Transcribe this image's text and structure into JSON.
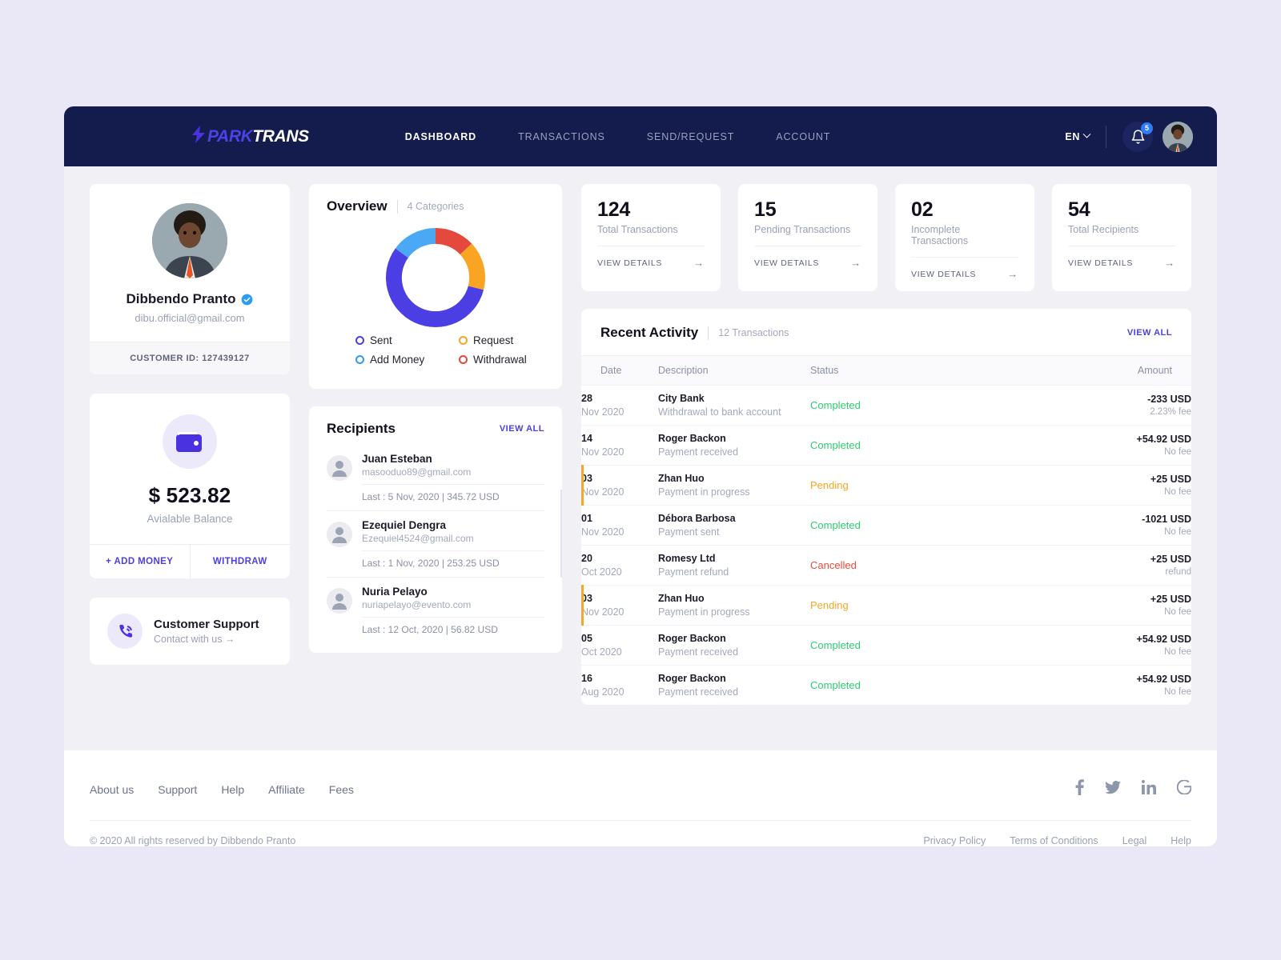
{
  "brand": {
    "bolt": "⚡",
    "park": "PARK",
    "trans": "TRANS"
  },
  "nav": {
    "items": [
      {
        "label": "DASHBOARD",
        "active": true
      },
      {
        "label": "TRANSACTIONS",
        "active": false
      },
      {
        "label": "SEND/REQUEST",
        "active": false
      },
      {
        "label": "ACCOUNT",
        "active": false
      }
    ],
    "language": "EN",
    "notification_count": "5"
  },
  "profile": {
    "name": "Dibbendo Pranto",
    "email": "dibu.official@gmail.com",
    "customer_id": "CUSTOMER ID: 127439127",
    "verified_icon": "verified-badge-icon"
  },
  "wallet": {
    "icon": "wallet-icon",
    "amount": "$ 523.82",
    "label": "Avialable Balance",
    "add_money": "+ ADD MONEY",
    "withdraw": "WITHDRAW"
  },
  "support": {
    "icon": "phone-call-icon",
    "title": "Customer Support",
    "subtitle": "Contact with us →"
  },
  "stats": [
    {
      "value": "124",
      "label": "Total Transactions",
      "link": "VIEW DETAILS"
    },
    {
      "value": "15",
      "label": "Pending Transactions",
      "link": "VIEW DETAILS"
    },
    {
      "value": "02",
      "label": "Incomplete Transactions",
      "link": "VIEW DETAILS"
    },
    {
      "value": "54",
      "label": "Total Recipients",
      "link": "VIEW DETAILS"
    }
  ],
  "overview": {
    "title": "Overview",
    "subtitle": "4  Categories"
  },
  "chart_data": {
    "type": "pie",
    "title": "Overview",
    "subtitle": "4 Categories",
    "legend_position": "bottom",
    "categories": [
      "Withdrawal",
      "Request",
      "Sent",
      "Add Money"
    ],
    "values": [
      13,
      16,
      56,
      15
    ],
    "colors": [
      "#e5483c",
      "#faa424",
      "#4b3fe4",
      "#4aa8f5"
    ],
    "legend": [
      {
        "label": "Sent",
        "color": "#4b3fe4"
      },
      {
        "label": "Request",
        "color": "#faa424"
      },
      {
        "label": "Add Money",
        "color": "#2f9bf5"
      },
      {
        "label": "Withdrawal",
        "color": "#e5483c"
      }
    ],
    "start_angle_deg": 0,
    "direction": "clockwise",
    "inner_radius_ratio": 0.68
  },
  "recipients": {
    "title": "Recipients",
    "view_all": "VIEW ALL",
    "items": [
      {
        "name": "Juan Esteban",
        "email": "masooduo89@gmail.com",
        "last": "Last : 5 Nov, 2020 | 345.72 USD"
      },
      {
        "name": "Ezequiel Dengra",
        "email": "Ezequiel4524@gmail.com",
        "last": "Last : 1 Nov, 2020 | 253.25 USD"
      },
      {
        "name": "Nuria Pelayo",
        "email": "nuriapelayo@evento.com",
        "last": "Last : 12 Oct, 2020 | 56.82 USD"
      }
    ]
  },
  "activity": {
    "title": "Recent Activity",
    "subtitle": "12 Transactions",
    "view_all": "VIEW ALL",
    "columns": [
      "Date",
      "Description",
      "Status",
      "Amount"
    ],
    "status_colors": {
      "Completed": "#2ecc71",
      "Pending": "#f5a623",
      "Cancelled": "#ec4b3a"
    },
    "rows": [
      {
        "day": "28",
        "month": "Nov 2020",
        "title": "City Bank",
        "sub": "Withdrawal to bank account",
        "status": "Completed",
        "amount": "-233 USD",
        "fee": "2.23% fee",
        "marked": false
      },
      {
        "day": "14",
        "month": "Nov 2020",
        "title": "Roger Backon",
        "sub": "Payment received",
        "status": "Completed",
        "amount": "+54.92 USD",
        "fee": "No fee",
        "marked": false
      },
      {
        "day": "03",
        "month": "Nov 2020",
        "title": "Zhan Huo",
        "sub": "Payment in progress",
        "status": "Pending",
        "amount": "+25 USD",
        "fee": "No fee",
        "marked": true
      },
      {
        "day": "01",
        "month": "Nov 2020",
        "title": "Débora Barbosa",
        "sub": "Payment sent",
        "status": "Completed",
        "amount": "-1021 USD",
        "fee": "No fee",
        "marked": false
      },
      {
        "day": "20",
        "month": "Oct 2020",
        "title": "Romesy Ltd",
        "sub": "Payment refund",
        "status": "Cancelled",
        "amount": "+25 USD",
        "fee": "refund",
        "marked": false
      },
      {
        "day": "03",
        "month": "Nov 2020",
        "title": "Zhan Huo",
        "sub": "Payment in progress",
        "status": "Pending",
        "amount": "+25 USD",
        "fee": "No fee",
        "marked": true
      },
      {
        "day": "05",
        "month": "Oct  2020",
        "title": "Roger Backon",
        "sub": "Payment received",
        "status": "Completed",
        "amount": "+54.92 USD",
        "fee": "No fee",
        "marked": false
      },
      {
        "day": "16",
        "month": "Aug 2020",
        "title": "Roger Backon",
        "sub": "Payment received",
        "status": "Completed",
        "amount": "+54.92 USD",
        "fee": "No fee",
        "marked": false
      }
    ]
  },
  "footer": {
    "links": [
      "About us",
      "Support",
      "Help",
      "Affiliate",
      "Fees"
    ],
    "social": [
      "facebook-icon",
      "twitter-icon",
      "linkedin-icon",
      "google-icon"
    ],
    "copyright": "© 2020 All rights reserved by Dibbendo Pranto",
    "legal": [
      "Privacy Policy",
      "Terms of Conditions",
      "Legal",
      "Help"
    ]
  },
  "theme": {
    "page_bg": "#eae8f6",
    "header_bg": "#141b4d",
    "accent": "#4b3fe4",
    "green": "#2ecc71",
    "orange": "#f5a623",
    "red": "#ec4b3a"
  }
}
